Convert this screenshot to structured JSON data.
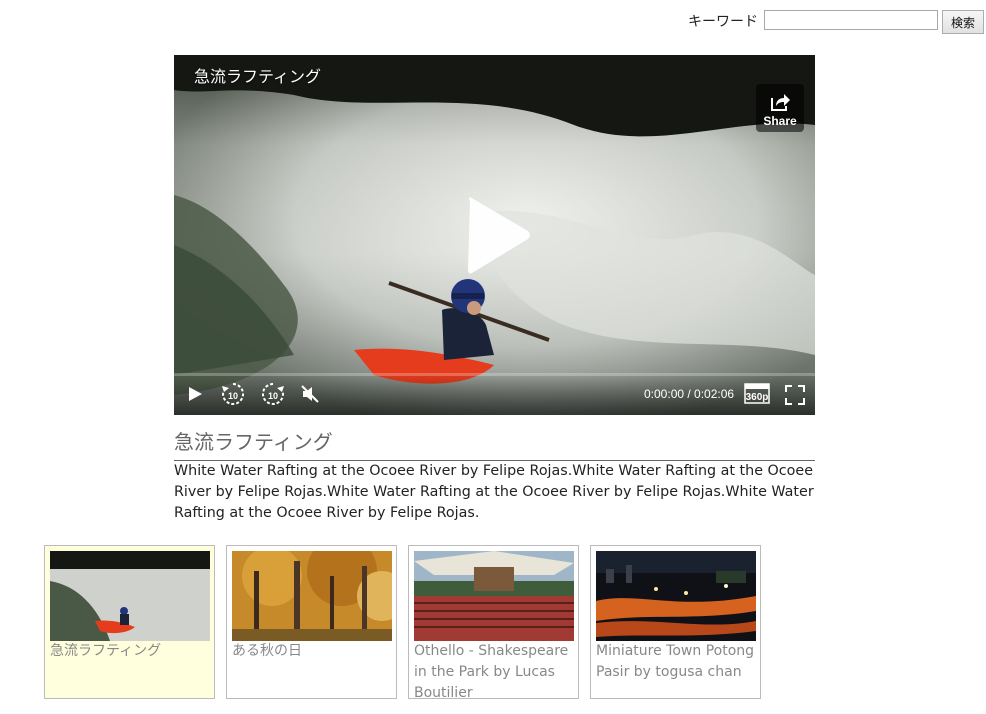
{
  "search": {
    "label": "キーワード",
    "value": "",
    "placeholder": "",
    "button_label": "検索"
  },
  "player": {
    "overlay_title": "急流ラフティング",
    "share_label": "Share",
    "current_time": "0:00:00",
    "duration": "0:02:06",
    "time_display": "0:00:00 / 0:02:06",
    "quality": "360p",
    "skip_seconds": "10",
    "progress": 0
  },
  "video": {
    "title": "急流ラフティング",
    "description": "White Water Rafting at the Ocoee River by Felipe Rojas.White Water Rafting at the Ocoee River by Felipe Rojas.White Water Rafting at the Ocoee River by Felipe Rojas.White Water Rafting at the Ocoee River by Felipe Rojas."
  },
  "playlist": [
    {
      "title": "急流ラフティング",
      "active": true
    },
    {
      "title": "ある秋の日",
      "active": false
    },
    {
      "title": "Othello - Shakespeare in the Park by Lucas Boutilier",
      "active": false
    },
    {
      "title": "Miniature Town Potong Pasir by togusa chan",
      "active": false
    }
  ],
  "icons": {
    "play": "play-icon",
    "rewind": "rewind-10-icon",
    "forward": "forward-10-icon",
    "mute": "mute-icon",
    "quality": "quality-icon",
    "fullscreen": "fullscreen-icon",
    "share": "share-icon"
  }
}
